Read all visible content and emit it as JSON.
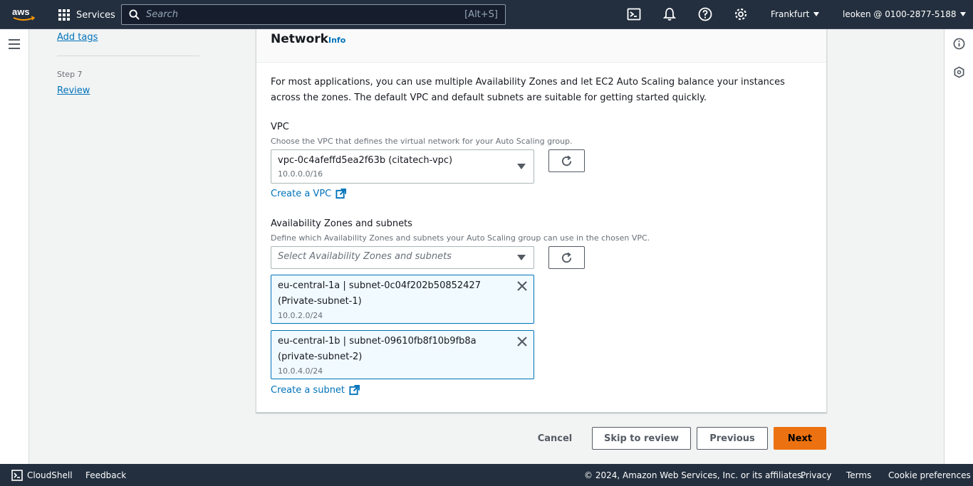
{
  "topnav": {
    "services_label": "Services",
    "search_placeholder": "Search",
    "search_shortcut": "[Alt+S]",
    "region_label": "Frankfurt",
    "account_label": "leoken @ 0100-2877-5188"
  },
  "steps": {
    "add_tags_label": "Add tags",
    "step7_label": "Step 7",
    "review_label": "Review"
  },
  "network": {
    "title": "Network",
    "info_label": "Info",
    "description": "For most applications, you can use multiple Availability Zones and let EC2 Auto Scaling balance your instances across the zones. The default VPC and default subnets are suitable for getting started quickly.",
    "vpc": {
      "label": "VPC",
      "description": "Choose the VPC that defines the virtual network for your Auto Scaling group.",
      "selected_value": "vpc-0c4afeffd5ea2f63b (citatech-vpc)",
      "selected_cidr": "10.0.0.0/16",
      "create_link": "Create a VPC"
    },
    "azs": {
      "label": "Availability Zones and subnets",
      "description": "Define which Availability Zones and subnets your Auto Scaling group can use in the chosen VPC.",
      "placeholder": "Select Availability Zones and subnets",
      "tokens": [
        {
          "line1": "eu-central-1a | subnet-0c04f202b50852427",
          "line2": "(Private-subnet-1)",
          "cidr": "10.0.2.0/24"
        },
        {
          "line1": "eu-central-1b | subnet-09610fb8f10b9fb8a",
          "line2": "(private-subnet-2)",
          "cidr": "10.0.4.0/24"
        }
      ],
      "create_link": "Create a subnet"
    }
  },
  "actions": {
    "cancel_label": "Cancel",
    "skip_label": "Skip to review",
    "previous_label": "Previous",
    "next_label": "Next"
  },
  "footer": {
    "cloudshell_label": "CloudShell",
    "feedback_label": "Feedback",
    "copyright": "© 2024, Amazon Web Services, Inc. or its affiliates.",
    "privacy_label": "Privacy",
    "terms_label": "Terms",
    "cookie_label": "Cookie preferences"
  },
  "colors": {
    "nav_bg": "#232f3e",
    "link": "#0073bb",
    "primary": "#ec7211",
    "token_bg": "#f1faff"
  }
}
